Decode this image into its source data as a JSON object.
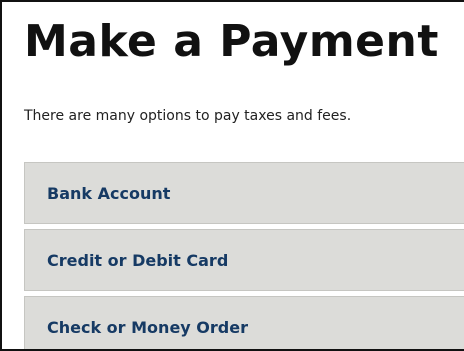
{
  "page": {
    "title": "Make a Payment",
    "intro": "There are many options to pay taxes and fees."
  },
  "options": [
    {
      "label": "Bank Account"
    },
    {
      "label": "Credit or Debit Card"
    },
    {
      "label": "Check or Money Order"
    }
  ],
  "colors": {
    "title": "#111111",
    "option_background": "#dcdcd9",
    "option_text": "#163a64"
  }
}
